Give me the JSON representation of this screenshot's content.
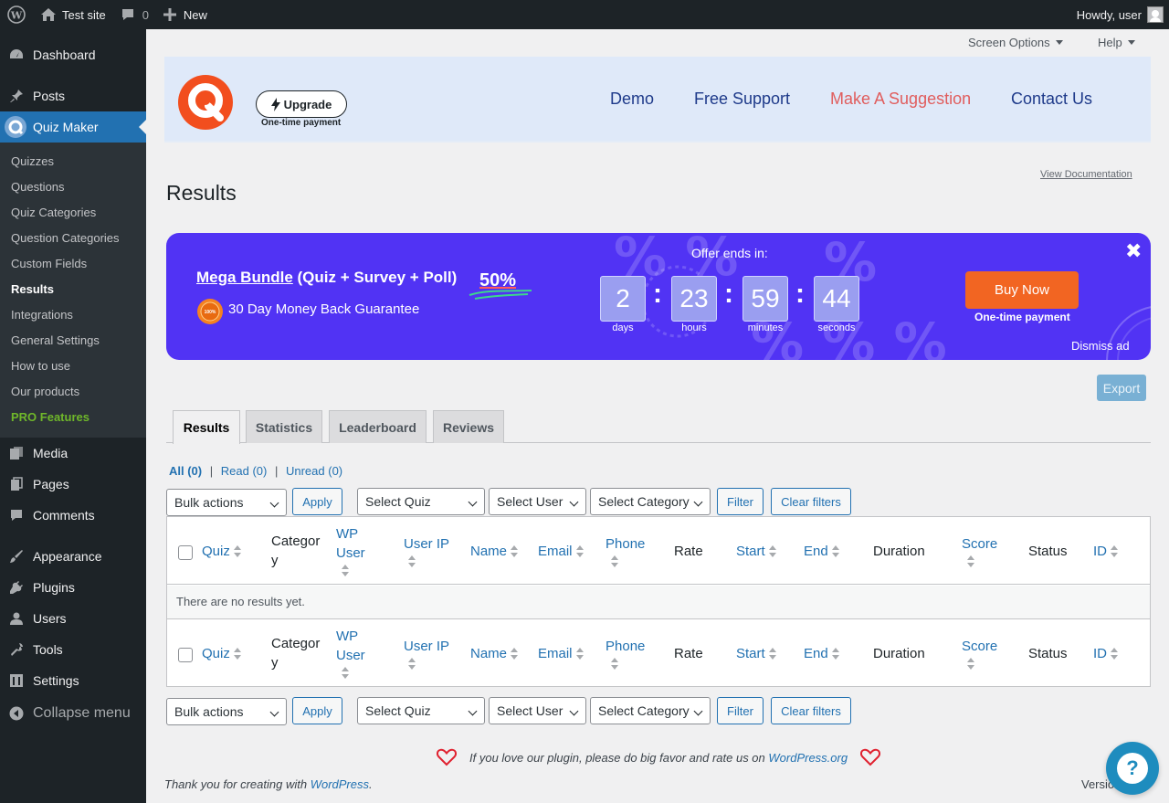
{
  "adminbar": {
    "site_name": "Test site",
    "comments_count": "0",
    "new_label": "New",
    "howdy": "Howdy, user"
  },
  "sidebar": {
    "items": [
      {
        "label": "Dashboard",
        "icon": "dashboard-icon"
      },
      {
        "label": "Posts",
        "icon": "pin-icon"
      },
      {
        "label": "Quiz Maker",
        "icon": "quiz-maker-icon"
      },
      {
        "label": "Media",
        "icon": "media-icon"
      },
      {
        "label": "Pages",
        "icon": "pages-icon"
      },
      {
        "label": "Comments",
        "icon": "comment-icon"
      },
      {
        "label": "Appearance",
        "icon": "brush-icon"
      },
      {
        "label": "Plugins",
        "icon": "plug-icon"
      },
      {
        "label": "Users",
        "icon": "user-icon"
      },
      {
        "label": "Tools",
        "icon": "wrench-icon"
      },
      {
        "label": "Settings",
        "icon": "settings-icon"
      },
      {
        "label": "Collapse menu",
        "icon": "collapse-icon"
      }
    ],
    "submenu": [
      "Quizzes",
      "Questions",
      "Quiz Categories",
      "Question Categories",
      "Custom Fields",
      "Results",
      "Integrations",
      "General Settings",
      "How to use",
      "Our products",
      "PRO Features"
    ]
  },
  "screen_meta": {
    "screen_options": "Screen Options",
    "help": "Help"
  },
  "plugin_header": {
    "upgrade_label": "Upgrade",
    "upgrade_note": "One-time payment",
    "links": [
      "Demo",
      "Free Support",
      "Make A Suggestion",
      "Contact Us"
    ]
  },
  "page": {
    "view_doc": "View Documentation",
    "title": "Results"
  },
  "promo": {
    "title_link": "Mega Bundle",
    "title_rest": " (Quiz + Survey + Poll)",
    "discount": "50%",
    "guarantee": "30 Day Money Back Guarantee",
    "badge": "100%",
    "offer_label": "Offer ends in:",
    "countdown": [
      {
        "value": "2",
        "label": "days"
      },
      {
        "value": "23",
        "label": "hours"
      },
      {
        "value": "59",
        "label": "minutes"
      },
      {
        "value": "44",
        "label": "seconds"
      }
    ],
    "buy_label": "Buy Now",
    "buy_note": "One-time payment",
    "dismiss": "Dismiss ad",
    "bg_color": "#5133f4",
    "buy_color": "#f26522"
  },
  "export_label": "Export",
  "tabs": [
    "Results",
    "Statistics",
    "Leaderboard",
    "Reviews"
  ],
  "views": {
    "all": "All (0)",
    "read": "Read (0)",
    "unread": "Unread (0)",
    "sep": "|"
  },
  "filters": {
    "bulk_actions": "Bulk actions",
    "apply": "Apply",
    "select_quiz": "Select Quiz",
    "select_user": "Select User",
    "select_category": "Select Category",
    "filter": "Filter",
    "clear_filters": "Clear filters"
  },
  "table": {
    "columns": {
      "quiz": "Quiz",
      "category_1": "Categor",
      "category_2": "y",
      "wp_user_1": "WP",
      "wp_user_2": "User",
      "user_ip": "User IP",
      "name": "Name",
      "email": "Email",
      "phone": "Phone",
      "rate": "Rate",
      "start": "Start",
      "end": "End",
      "duration": "Duration",
      "score": "Score",
      "status": "Status",
      "id": "ID"
    },
    "empty_message": "There are no results yet."
  },
  "footer": {
    "rate_text": "If you love our plugin, please do big favor and rate us on ",
    "rate_link": "WordPress.org",
    "thanks_text": "Thank you for creating with ",
    "thanks_link": "WordPress",
    "thanks_end": ".",
    "version": "Versio",
    "help_bubble": "?"
  }
}
